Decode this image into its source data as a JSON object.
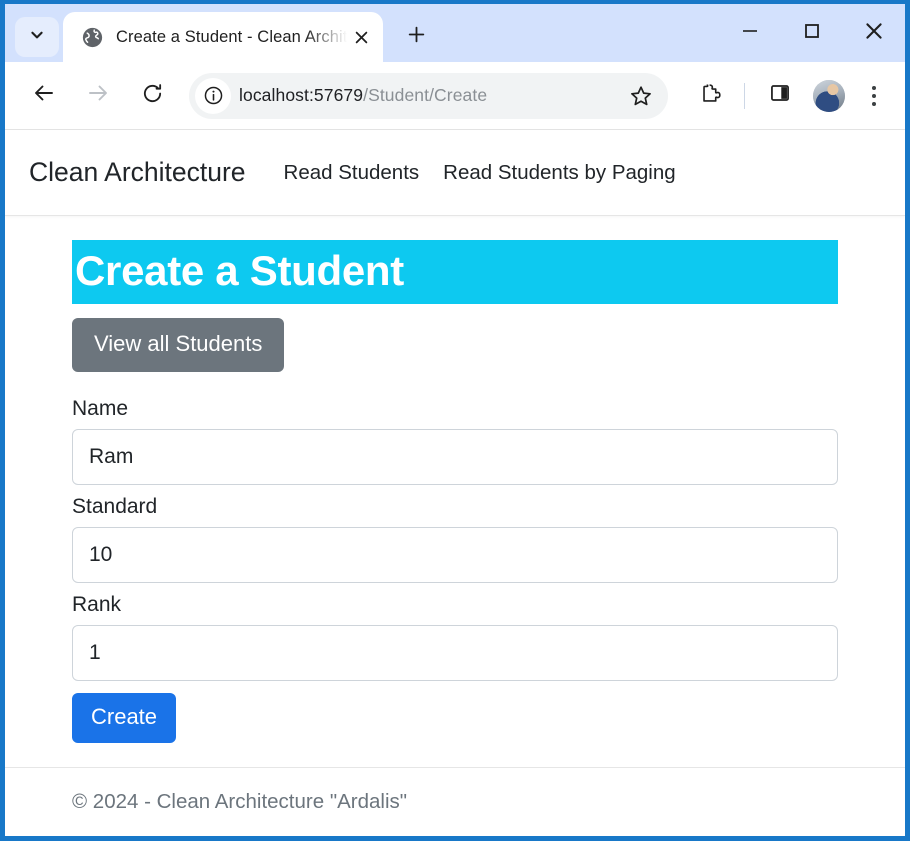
{
  "browser": {
    "tab_search_icon": "chevron-down-icon",
    "tab": {
      "favicon": "globe-favicon",
      "title": "Create a Student - Clean Archite",
      "close_icon": "close-icon"
    },
    "new_tab_icon": "plus-icon",
    "window_controls": {
      "minimize": "minimize-icon",
      "maximize": "maximize-icon",
      "close": "close-icon"
    },
    "toolbar": {
      "back_icon": "back-arrow-icon",
      "forward_icon": "forward-arrow-icon",
      "reload_icon": "reload-icon",
      "site_info_icon": "info-circle-icon",
      "url_host": "localhost:57679",
      "url_path": "/Student/Create",
      "bookmark_icon": "star-icon",
      "extensions_icon": "puzzle-piece-icon",
      "side_panel_icon": "side-panel-icon",
      "profile_icon": "avatar",
      "menu_icon": "three-dots-icon"
    }
  },
  "page": {
    "navbar": {
      "brand": "Clean Architecture",
      "links": [
        {
          "label": "Read Students"
        },
        {
          "label": "Read Students by Paging"
        }
      ]
    },
    "heading": "Create a Student",
    "view_all_button": "View all Students",
    "form": {
      "fields": [
        {
          "label": "Name",
          "value": "Ram",
          "placeholder": ""
        },
        {
          "label": "Standard",
          "value": "10",
          "placeholder": ""
        },
        {
          "label": "Rank",
          "value": "1",
          "placeholder": ""
        }
      ],
      "submit_label": "Create"
    },
    "footer": "© 2024 - Clean Architecture \"Ardalis\""
  },
  "colors": {
    "heading_bg": "#0dc9f0",
    "primary_button": "#1a73e8",
    "secondary_button": "#6c757d",
    "window_border": "#1878c8",
    "tabstrip_bg": "#d3e1fd"
  }
}
